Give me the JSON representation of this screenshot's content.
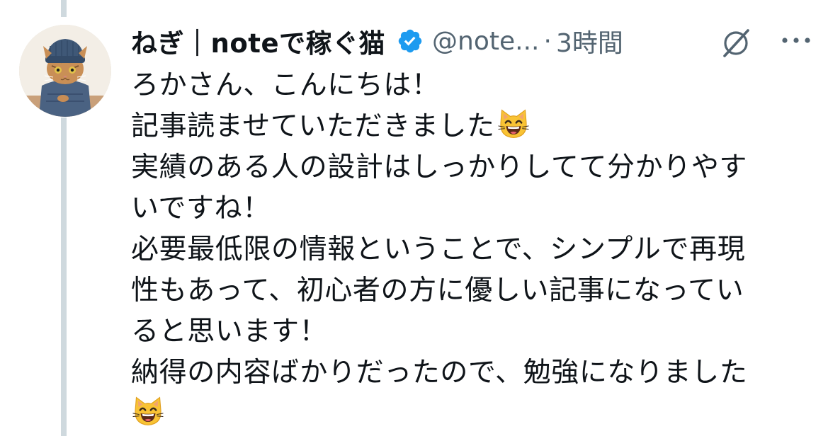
{
  "tweet": {
    "author": {
      "display_name": "ねぎ｜noteで稼ぐ猫",
      "handle": "@note...",
      "verified": true,
      "avatar_description": "cat-avatar"
    },
    "separator": "·",
    "timestamp": "3時間",
    "body_lines": [
      "ろかさん、こんにちは！",
      "記事読ませていただきました",
      "実績のある人の設計はしっかりしてて分かりやす",
      "いですね！",
      "必要最低限の情報ということで、シンプルで再現",
      "性もあって、初心者の方に優しい記事になってい",
      "ると思います！",
      "納得の内容ばかりだったので、勉強になりました",
      ""
    ],
    "emoji": "grinning-cat-emoji"
  },
  "icons": {
    "verified": "verified-badge-icon",
    "grok": "grok-icon",
    "more": "more-options-icon"
  },
  "colors": {
    "verified_blue": "#1d9bf0",
    "secondary_text": "#536471",
    "primary_text": "#0f1419",
    "thread_line": "#cfd9de"
  }
}
